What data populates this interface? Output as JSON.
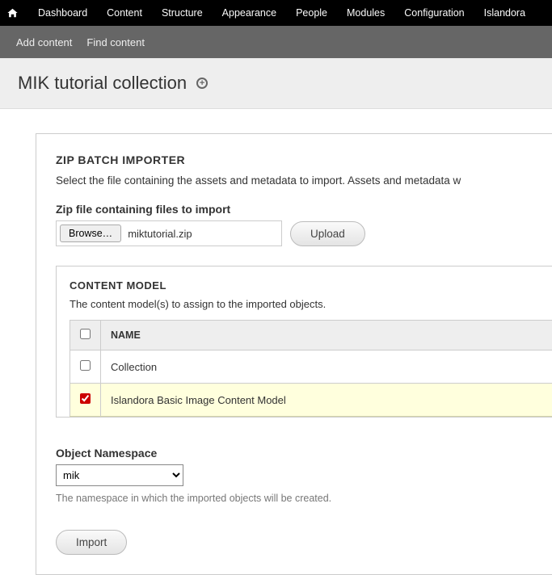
{
  "adminBar": {
    "items": [
      "Dashboard",
      "Content",
      "Structure",
      "Appearance",
      "People",
      "Modules",
      "Configuration",
      "Islandora"
    ]
  },
  "shortcutBar": {
    "addContent": "Add content",
    "findContent": "Find content"
  },
  "pageTitle": "MIK tutorial collection",
  "importer": {
    "title": "ZIP BATCH IMPORTER",
    "description": "Select the file containing the assets and metadata to import. Assets and metadata w",
    "fileLabel": "Zip file containing files to import",
    "browseLabel": "Browse…",
    "fileName": "miktutorial.zip",
    "uploadLabel": "Upload"
  },
  "contentModel": {
    "title": "CONTENT MODEL",
    "description": "The content model(s) to assign to the imported objects.",
    "headerName": "NAME",
    "rows": [
      {
        "label": "Collection",
        "checked": false
      },
      {
        "label": "Islandora Basic Image Content Model",
        "checked": true
      }
    ]
  },
  "namespace": {
    "label": "Object Namespace",
    "value": "mik",
    "helper": "The namespace in which the imported objects will be created."
  },
  "importLabel": "Import"
}
